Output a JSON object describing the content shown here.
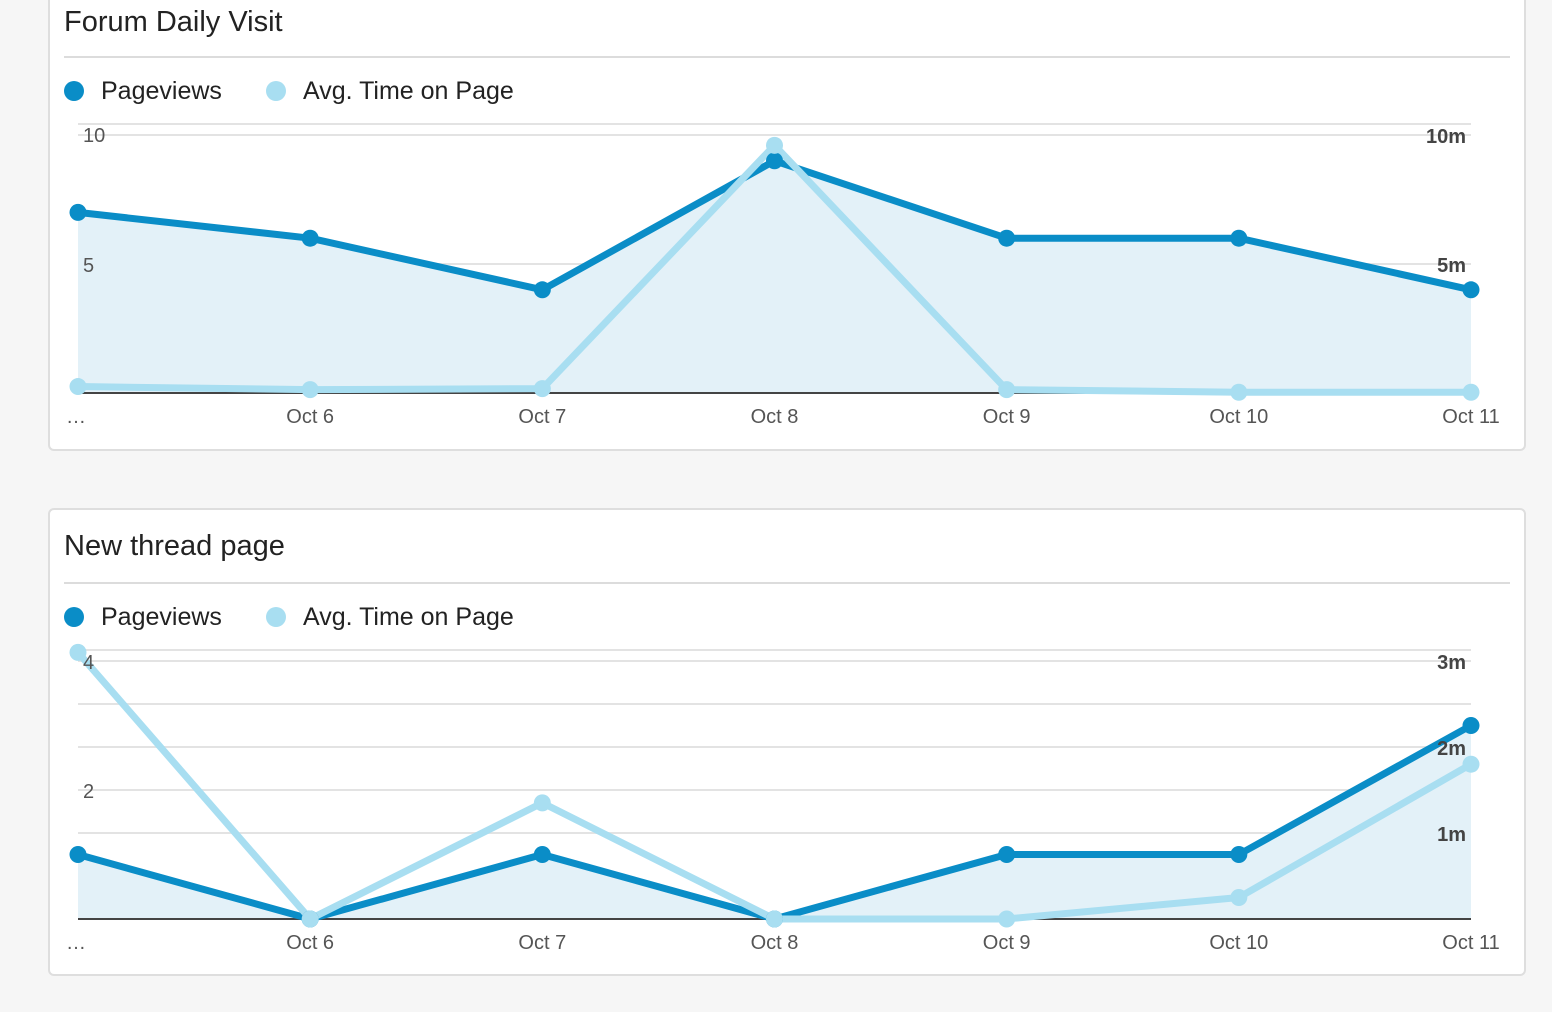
{
  "colors": {
    "pageviews": "#0a8dc7",
    "avg_time": "#a8def1",
    "area_fill": "#e3f1f8",
    "gridline": "#e3e3e3",
    "baseline": "#444444",
    "tick_text": "#555555",
    "right_tick_text": "#444444"
  },
  "chart_data": [
    {
      "type": "line",
      "title": "Forum Daily Visit",
      "x_labels": [
        "…",
        "Oct 6",
        "Oct 7",
        "Oct 8",
        "Oct 9",
        "Oct 10",
        "Oct 11"
      ],
      "series": [
        {
          "name": "Pageviews",
          "axis": "left",
          "values": [
            7,
            6,
            4,
            9,
            6,
            6,
            4
          ]
        },
        {
          "name": "Avg. Time on Page",
          "axis": "right",
          "unit": "minutes",
          "values": [
            0.25,
            0.13,
            0.17,
            9.6,
            0.13,
            0.03,
            0.03
          ]
        }
      ],
      "left_axis": {
        "range": [
          0,
          10
        ],
        "ticks": [
          {
            "value": 5,
            "label": "5"
          },
          {
            "value": 10,
            "label": "10"
          }
        ]
      },
      "right_axis": {
        "range": [
          0,
          10
        ],
        "ticks": [
          {
            "value": 5,
            "label": "5m"
          },
          {
            "value": 10,
            "label": "10m"
          }
        ]
      },
      "gridlines": [
        5,
        10
      ],
      "legend": "top-left",
      "grid": true
    },
    {
      "type": "line",
      "title": "New thread page",
      "x_labels": [
        "…",
        "Oct 6",
        "Oct 7",
        "Oct 8",
        "Oct 9",
        "Oct 10",
        "Oct 11"
      ],
      "series": [
        {
          "name": "Pageviews",
          "axis": "left",
          "values": [
            1,
            0,
            1,
            0,
            1,
            1,
            3
          ]
        },
        {
          "name": "Avg. Time on Page",
          "axis": "right",
          "unit": "minutes",
          "values": [
            3.1,
            0,
            1.35,
            0,
            0,
            0.25,
            1.8
          ]
        }
      ],
      "left_axis": {
        "range": [
          0,
          4
        ],
        "ticks": [
          {
            "value": 2,
            "label": "2"
          },
          {
            "value": 4,
            "label": "4"
          }
        ]
      },
      "right_axis": {
        "range": [
          0,
          3
        ],
        "ticks": [
          {
            "value": 1,
            "label": "1m"
          },
          {
            "value": 2,
            "label": "2m"
          },
          {
            "value": 3,
            "label": "3m"
          }
        ]
      },
      "gridlines": [
        1,
        1.5,
        2,
        2.5,
        3
      ],
      "legend": "top-left",
      "grid": true
    }
  ]
}
